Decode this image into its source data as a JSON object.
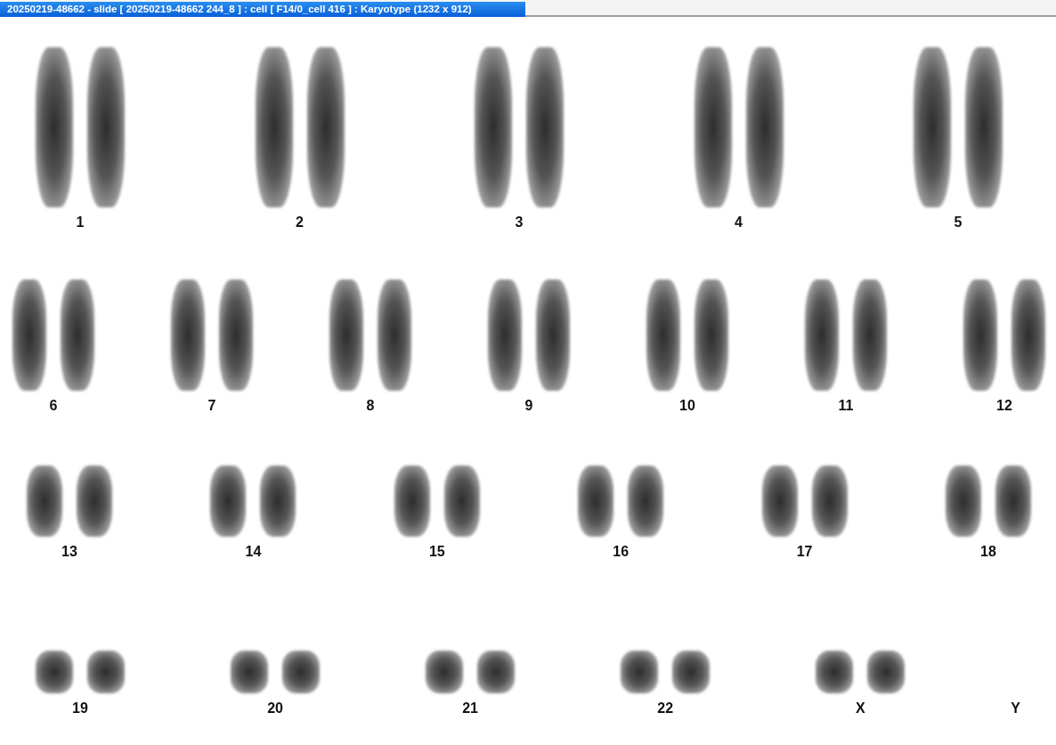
{
  "window": {
    "title": "20250219-48662 - slide [ 20250219-48662 244_8 ] : cell [ F14/0_cell 416 ] : Karyotype  (1232 x 912)"
  },
  "karyotype": {
    "rows": [
      {
        "pairs": [
          {
            "label": "1",
            "kind": "pair"
          },
          {
            "label": "2",
            "kind": "pair"
          },
          {
            "label": "3",
            "kind": "pair"
          },
          {
            "label": "4",
            "kind": "pair"
          },
          {
            "label": "5",
            "kind": "pair"
          }
        ]
      },
      {
        "pairs": [
          {
            "label": "6",
            "kind": "pair"
          },
          {
            "label": "7",
            "kind": "pair"
          },
          {
            "label": "8",
            "kind": "pair"
          },
          {
            "label": "9",
            "kind": "pair"
          },
          {
            "label": "10",
            "kind": "pair"
          },
          {
            "label": "11",
            "kind": "pair"
          },
          {
            "label": "12",
            "kind": "pair"
          }
        ]
      },
      {
        "pairs": [
          {
            "label": "13",
            "kind": "pair"
          },
          {
            "label": "14",
            "kind": "pair"
          },
          {
            "label": "15",
            "kind": "pair"
          },
          {
            "label": "16",
            "kind": "pair"
          },
          {
            "label": "17",
            "kind": "pair"
          },
          {
            "label": "18",
            "kind": "pair"
          }
        ]
      },
      {
        "pairs": [
          {
            "label": "19",
            "kind": "pair"
          },
          {
            "label": "20",
            "kind": "pair"
          },
          {
            "label": "21",
            "kind": "pair"
          },
          {
            "label": "22",
            "kind": "pair"
          },
          {
            "label": "X",
            "kind": "pair"
          },
          {
            "label": "Y",
            "kind": "empty"
          }
        ]
      }
    ]
  }
}
